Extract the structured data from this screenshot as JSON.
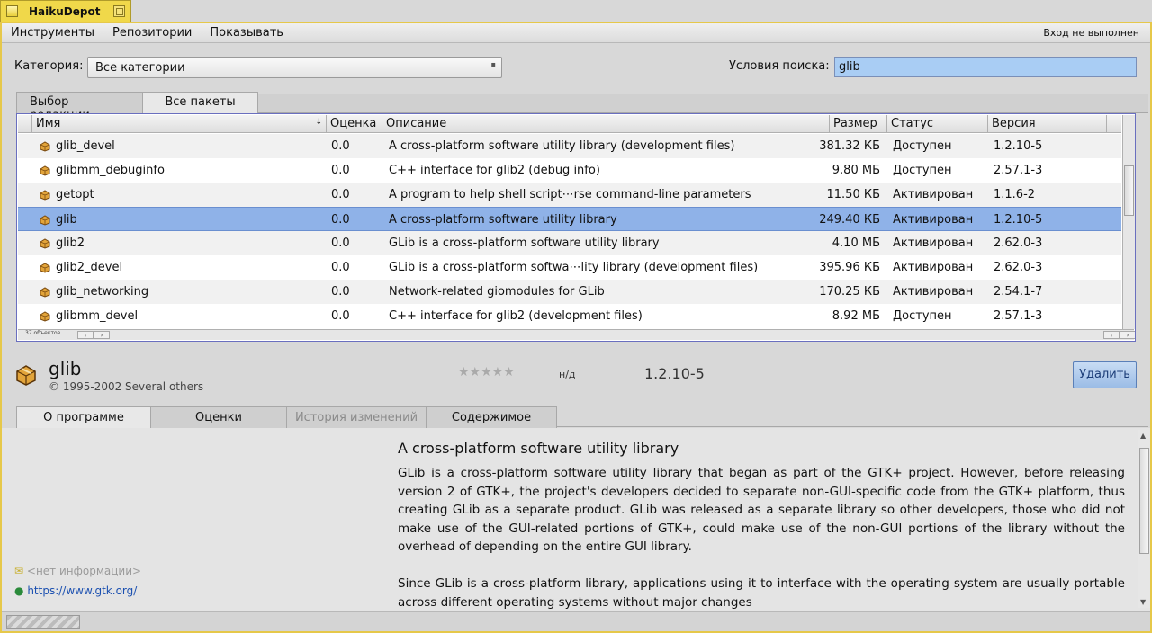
{
  "window": {
    "title": "HaikuDepot"
  },
  "menu": {
    "items": [
      "Инструменты",
      "Репозитории",
      "Показывать"
    ],
    "login_status": "Вход не выполнен"
  },
  "filters": {
    "category_label": "Категория:",
    "category_value": "Все категории",
    "search_label": "Условия поиска:",
    "search_value": "glib"
  },
  "tabs_top": [
    "Выбор редакции",
    "Все пакеты"
  ],
  "table": {
    "headers": [
      "Имя",
      "Оценка",
      "Описание",
      "Размер",
      "Статус",
      "Версия"
    ],
    "rows": [
      {
        "name": "glib_devel",
        "rating": "0.0",
        "desc": "A cross-platform software utility library (development files)",
        "size": "381.32 КБ",
        "status": "Доступен",
        "version": "1.2.10-5"
      },
      {
        "name": "glibmm_debuginfo",
        "rating": "0.0",
        "desc": "C++ interface for glib2 (debug info)",
        "size": "9.80 МБ",
        "status": "Доступен",
        "version": "2.57.1-3"
      },
      {
        "name": "getopt",
        "rating": "0.0",
        "desc": "A program to help shell script⋯rse command-line parameters",
        "size": "11.50 КБ",
        "status": "Активирован",
        "version": "1.1.6-2"
      },
      {
        "name": "glib",
        "rating": "0.0",
        "desc": "A cross-platform software utility library",
        "size": "249.40 КБ",
        "status": "Активирован",
        "version": "1.2.10-5"
      },
      {
        "name": "glib2",
        "rating": "0.0",
        "desc": "GLib is a cross-platform software utility library",
        "size": "4.10 МБ",
        "status": "Активирован",
        "version": "2.62.0-3"
      },
      {
        "name": "glib2_devel",
        "rating": "0.0",
        "desc": "GLib is a cross-platform softwa⋯lity library (development files)",
        "size": "395.96 КБ",
        "status": "Активирован",
        "version": "2.62.0-3"
      },
      {
        "name": "glib_networking",
        "rating": "0.0",
        "desc": "Network-related giomodules for GLib",
        "size": "170.25 КБ",
        "status": "Активирован",
        "version": "2.54.1-7"
      },
      {
        "name": "glibmm_devel",
        "rating": "0.0",
        "desc": "C++ interface for glib2 (development files)",
        "size": "8.92 МБ",
        "status": "Доступен",
        "version": "2.57.1-3"
      }
    ],
    "count_label": "37 объектов"
  },
  "package": {
    "name": "glib",
    "copyright": "© 1995-2002 Several others",
    "stars": "★★★★★",
    "rating_na": "н/д",
    "version": "1.2.10-5",
    "remove_label": "Удалить"
  },
  "tabs_bottom": [
    "О программе",
    "Оценки",
    "История изменений",
    "Содержимое"
  ],
  "about": {
    "title": "A cross-platform software utility library",
    "p1": "GLib is a cross-platform software utility library that began as part of the GTK+ project. However, before releasing version 2 of GTK+, the project's developers decided to separate non-GUI-specific code from the GTK+ platform, thus creating GLib as a separate product. GLib was released as a separate library so other developers, those who did not make use of the GUI-related portions of GTK+, could make use of the non-GUI portions of the library without the overhead of depending on the entire GUI library.",
    "p2": "Since GLib is a cross-platform library, applications using it to interface with the operating system are usually portable across different operating systems without major changes",
    "publisher": "<нет информации>",
    "website": "https://www.gtk.org/"
  },
  "colors": {
    "selection": "#8fb2e8",
    "window_tab": "#f0d84a",
    "search_highlight": "#a9cdf4"
  }
}
